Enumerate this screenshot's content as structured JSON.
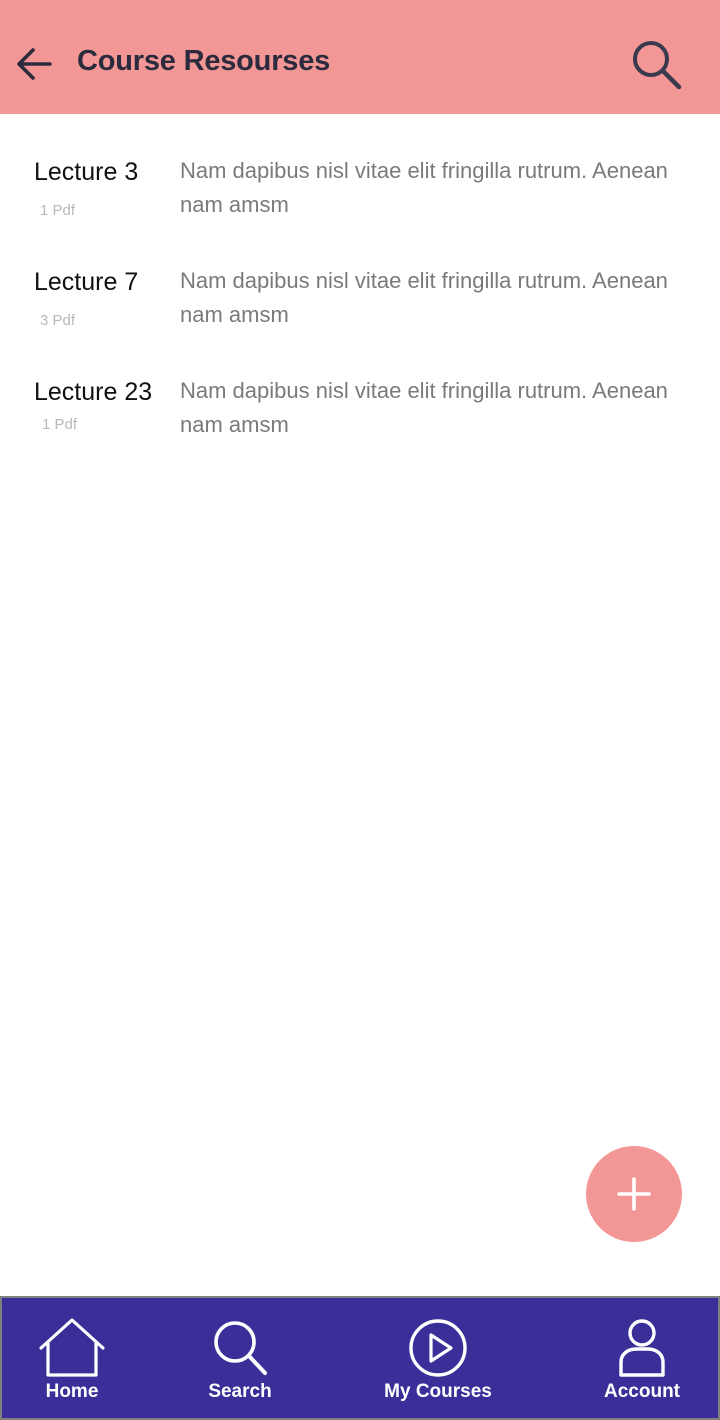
{
  "header": {
    "title": "Course Resourses",
    "back_icon": "arrow-left-icon",
    "search_icon": "search-icon",
    "background": "#f29795"
  },
  "resources": [
    {
      "title": "Lecture 3",
      "count": "1 Pdf",
      "description": "Nam dapibus nisl vitae elit fringilla rutrum. Aenean nam amsm"
    },
    {
      "title": "Lecture 7",
      "count": "3 Pdf",
      "description": "Nam dapibus nisl vitae elit fringilla rutrum. Aenean nam amsm"
    },
    {
      "title": "Lecture 23",
      "count": "1 Pdf",
      "description": "Nam dapibus nisl vitae elit fringilla rutrum. Aenean nam amsm"
    }
  ],
  "fab": {
    "icon": "plus-icon",
    "color": "#f29795"
  },
  "tabbar": {
    "background": "#3a2f99",
    "tabs": [
      {
        "label": "Home",
        "icon": "home-icon"
      },
      {
        "label": "Search",
        "icon": "search-icon"
      },
      {
        "label": "My Courses",
        "icon": "play-circle-icon"
      },
      {
        "label": "Account",
        "icon": "user-icon"
      }
    ]
  }
}
